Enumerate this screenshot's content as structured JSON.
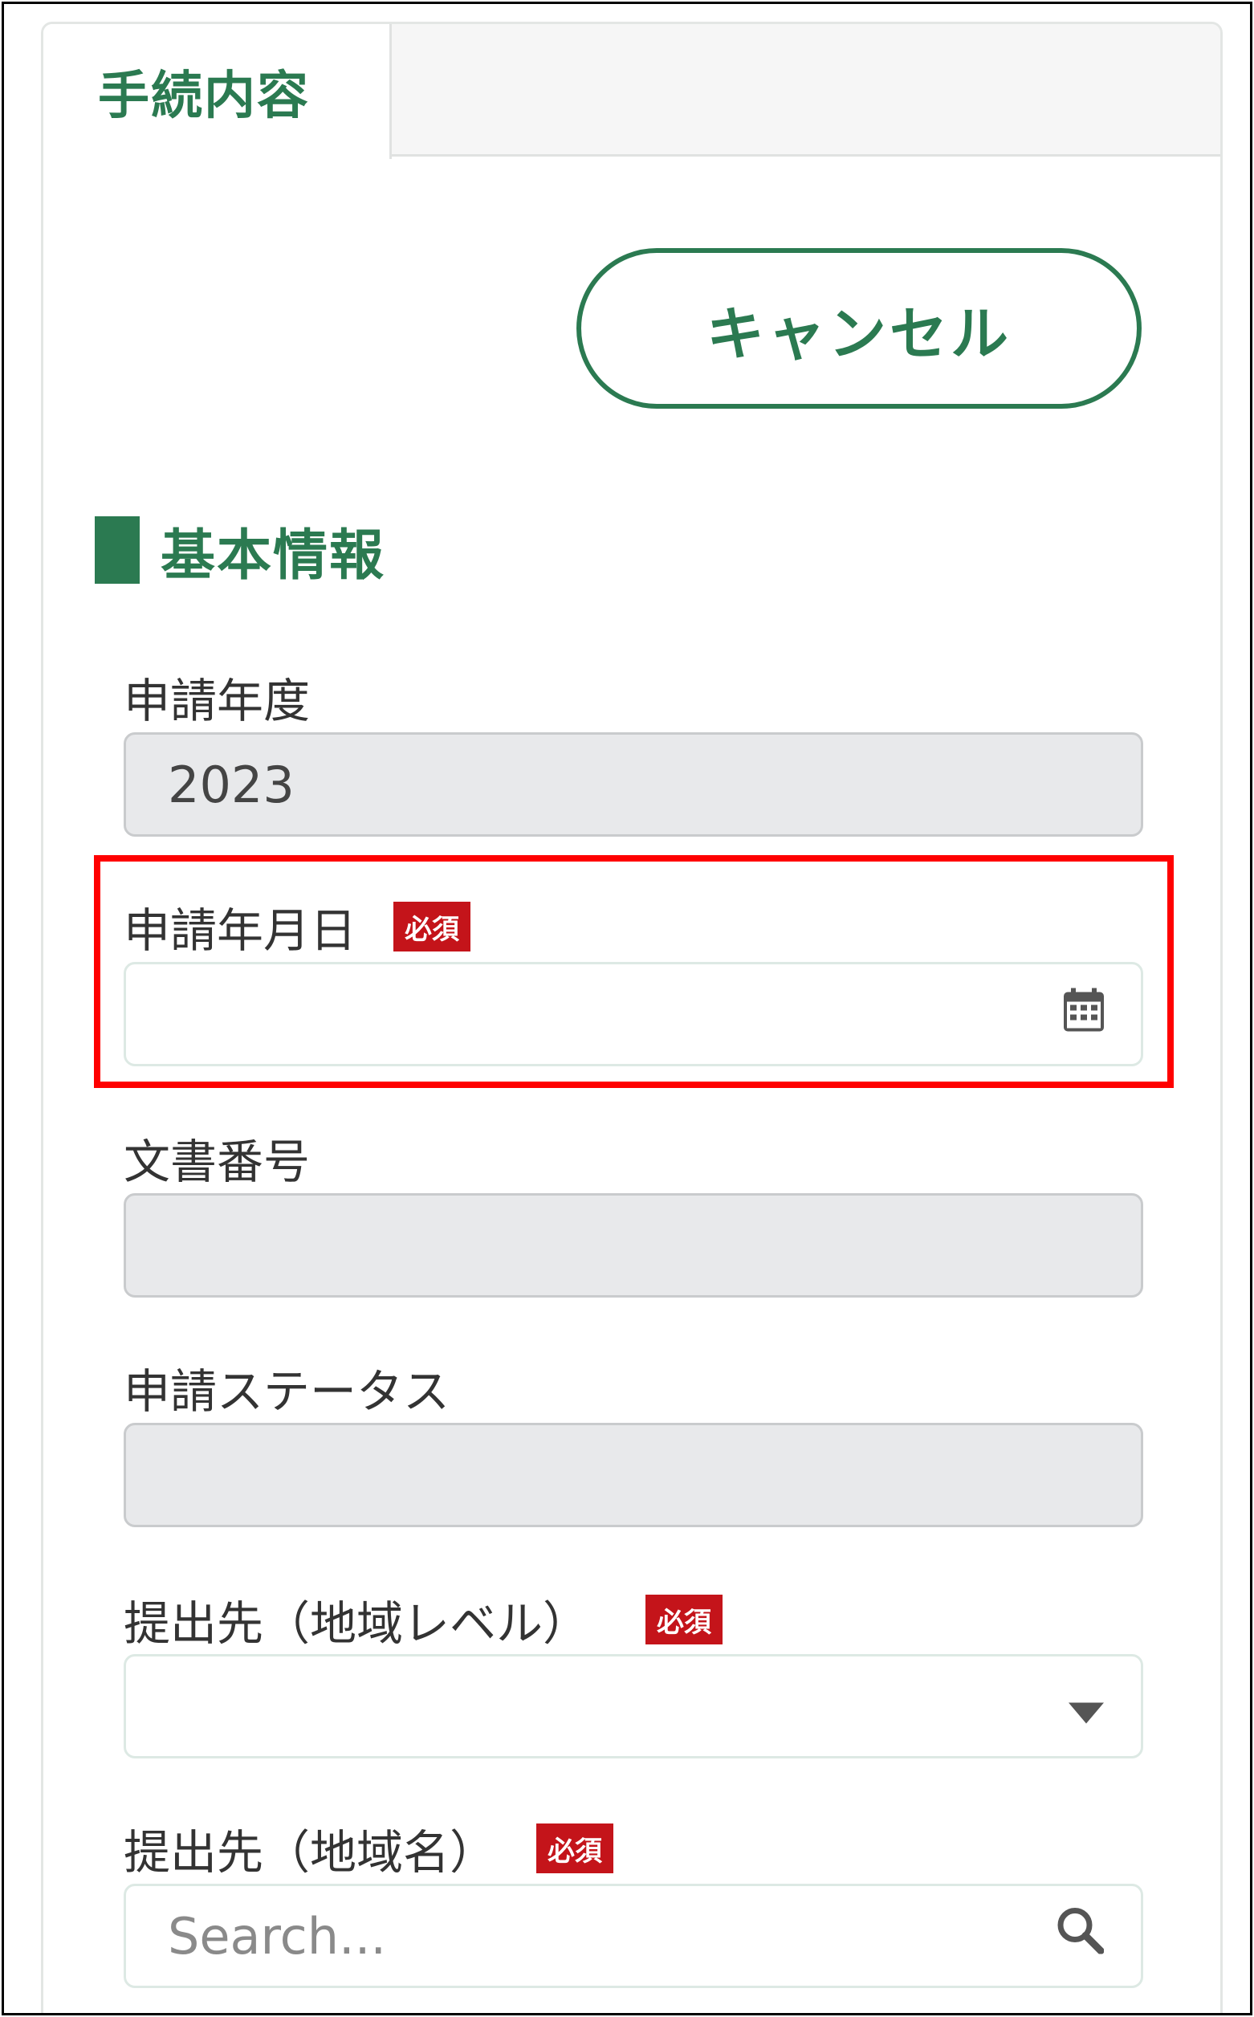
{
  "tab": {
    "label": "手続内容"
  },
  "actions": {
    "cancel_label": "キャンセル"
  },
  "section": {
    "title": "基本情報"
  },
  "badges": {
    "required": "必須"
  },
  "fields": {
    "application_year": {
      "label": "申請年度",
      "value": "2023"
    },
    "application_date": {
      "label": "申請年月日",
      "value": ""
    },
    "document_number": {
      "label": "文書番号",
      "value": ""
    },
    "application_status": {
      "label": "申請ステータス",
      "value": ""
    },
    "submission_region_level": {
      "label": "提出先（地域レベル）",
      "value": ""
    },
    "submission_region_name": {
      "label": "提出先（地域名）",
      "placeholder": "Search..."
    }
  },
  "colors": {
    "accent": "#2b7a51",
    "required_badge": "#c4141a",
    "highlight": "#ff0000",
    "disabled_bg": "#e8e9eb"
  },
  "icons": {
    "date_picker": "calendar-icon",
    "dropdown": "caret-down-icon",
    "search": "search-icon"
  }
}
